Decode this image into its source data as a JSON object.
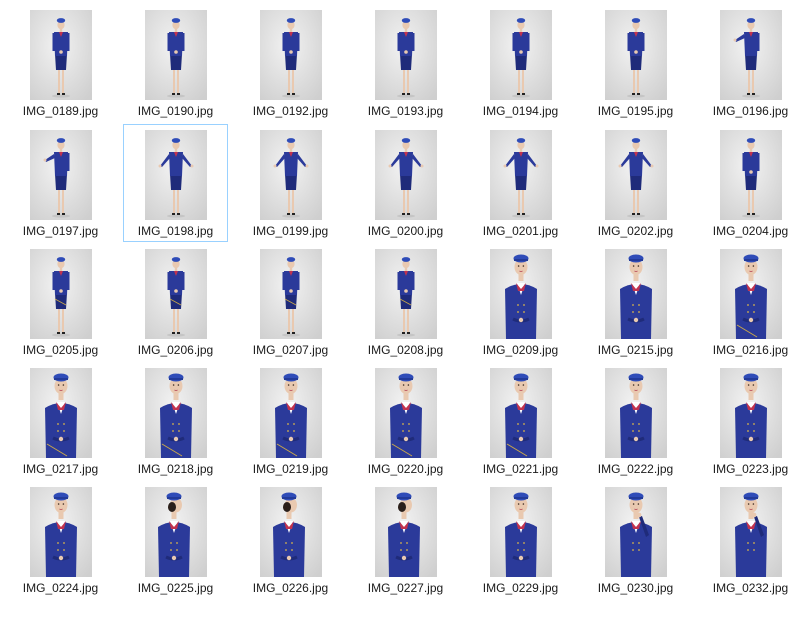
{
  "view": {
    "type": "large-icons",
    "selected_index": 8
  },
  "files": [
    {
      "name": "IMG_0189.jpg",
      "pose": "full-standing"
    },
    {
      "name": "IMG_0190.jpg",
      "pose": "full-standing"
    },
    {
      "name": "IMG_0192.jpg",
      "pose": "full-standing"
    },
    {
      "name": "IMG_0193.jpg",
      "pose": "full-standing"
    },
    {
      "name": "IMG_0194.jpg",
      "pose": "full-standing"
    },
    {
      "name": "IMG_0195.jpg",
      "pose": "full-standing"
    },
    {
      "name": "IMG_0196.jpg",
      "pose": "full-arm-out"
    },
    {
      "name": "IMG_0197.jpg",
      "pose": "full-arm-out"
    },
    {
      "name": "IMG_0198.jpg",
      "pose": "full-arms-out"
    },
    {
      "name": "IMG_0199.jpg",
      "pose": "full-arms-out"
    },
    {
      "name": "IMG_0200.jpg",
      "pose": "full-arms-out"
    },
    {
      "name": "IMG_0201.jpg",
      "pose": "full-arms-out"
    },
    {
      "name": "IMG_0202.jpg",
      "pose": "full-arms-out"
    },
    {
      "name": "IMG_0204.jpg",
      "pose": "full-standing"
    },
    {
      "name": "IMG_0205.jpg",
      "pose": "full-side"
    },
    {
      "name": "IMG_0206.jpg",
      "pose": "full-side"
    },
    {
      "name": "IMG_0207.jpg",
      "pose": "full-side"
    },
    {
      "name": "IMG_0208.jpg",
      "pose": "full-side"
    },
    {
      "name": "IMG_0209.jpg",
      "pose": "half-front"
    },
    {
      "name": "IMG_0215.jpg",
      "pose": "half-front"
    },
    {
      "name": "IMG_0216.jpg",
      "pose": "half-side"
    },
    {
      "name": "IMG_0217.jpg",
      "pose": "half-side"
    },
    {
      "name": "IMG_0218.jpg",
      "pose": "half-side"
    },
    {
      "name": "IMG_0219.jpg",
      "pose": "half-side"
    },
    {
      "name": "IMG_0220.jpg",
      "pose": "half-side"
    },
    {
      "name": "IMG_0221.jpg",
      "pose": "half-side"
    },
    {
      "name": "IMG_0222.jpg",
      "pose": "half-front"
    },
    {
      "name": "IMG_0223.jpg",
      "pose": "half-front"
    },
    {
      "name": "IMG_0224.jpg",
      "pose": "half-front"
    },
    {
      "name": "IMG_0225.jpg",
      "pose": "half-profile"
    },
    {
      "name": "IMG_0226.jpg",
      "pose": "half-profile"
    },
    {
      "name": "IMG_0227.jpg",
      "pose": "half-profile"
    },
    {
      "name": "IMG_0229.jpg",
      "pose": "half-front"
    },
    {
      "name": "IMG_0230.jpg",
      "pose": "half-hand-face"
    },
    {
      "name": "IMG_0232.jpg",
      "pose": "half-hand-face"
    }
  ],
  "colors": {
    "uniform": "#2b3a9a",
    "uniform_dark": "#1f2b7a",
    "hat": "#2f4cb8",
    "scarf": "#c2334f",
    "skin": "#e9c9b0",
    "backdrop_light": "#f2f2f2",
    "backdrop_dark": "#cfcfcf",
    "selection_border": "#99d1ff"
  }
}
